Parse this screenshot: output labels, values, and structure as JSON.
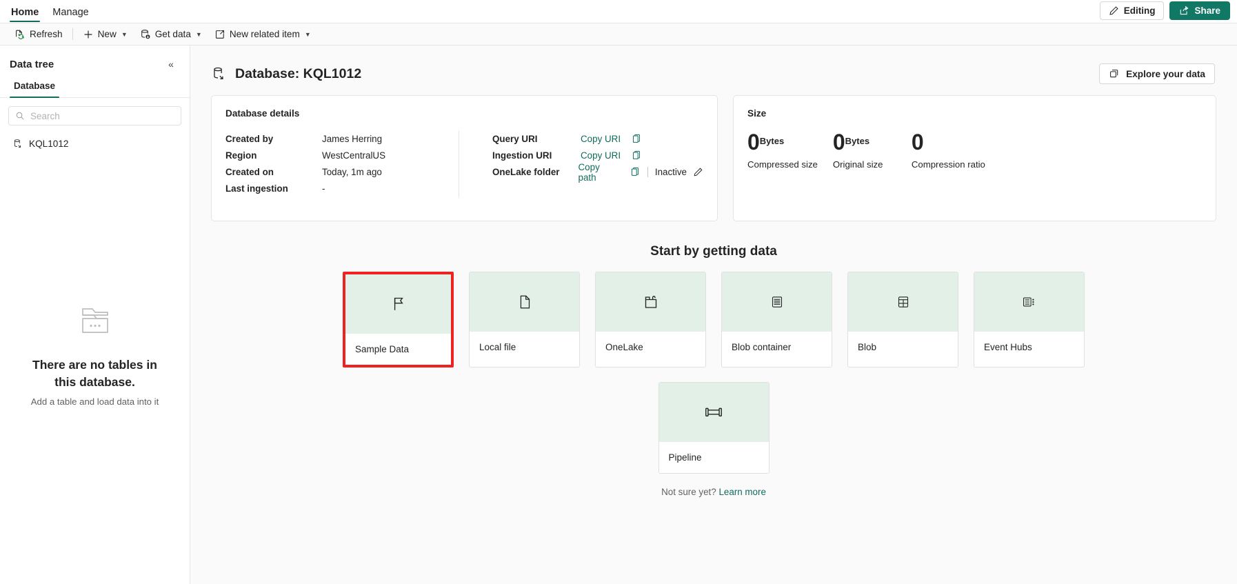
{
  "ribbon": {
    "tabs": [
      {
        "label": "Home",
        "active": true
      },
      {
        "label": "Manage",
        "active": false
      }
    ],
    "editing_label": "Editing",
    "share_label": "Share"
  },
  "commandbar": {
    "items": [
      {
        "label": "Refresh",
        "icon": "refresh-icon",
        "caret": false
      },
      {
        "label": "New",
        "icon": "plus-icon",
        "caret": true
      },
      {
        "label": "Get data",
        "icon": "get-data-icon",
        "caret": true
      },
      {
        "label": "New related item",
        "icon": "open-external-icon",
        "caret": true
      }
    ]
  },
  "sidebar": {
    "title": "Data tree",
    "collapse_glyph": "«",
    "tabs": [
      {
        "label": "Database",
        "active": true
      }
    ],
    "search": {
      "placeholder": "Search",
      "value": ""
    },
    "tree": [
      {
        "label": "KQL1012",
        "icon": "database-icon"
      }
    ],
    "empty": {
      "title": "There are no tables in this database.",
      "subtitle": "Add a table and load data into it"
    }
  },
  "main": {
    "page_title": "Database: KQL1012",
    "explore_button": "Explore your data",
    "details": {
      "title": "Database details",
      "left_rows": [
        {
          "label": "Created by",
          "value": "James Herring"
        },
        {
          "label": "Region",
          "value": "WestCentralUS"
        },
        {
          "label": "Created on",
          "value": "Today, 1m ago"
        },
        {
          "label": "Last ingestion",
          "value": "-"
        }
      ],
      "right_rows": [
        {
          "label": "Query URI",
          "link": "Copy URI",
          "extra": ""
        },
        {
          "label": "Ingestion URI",
          "link": "Copy URI",
          "extra": ""
        },
        {
          "label": "OneLake folder",
          "link": "Copy path",
          "extra": "Inactive"
        }
      ]
    },
    "size": {
      "title": "Size",
      "stats": [
        {
          "number": "0",
          "unit": "Bytes",
          "label": "Compressed size"
        },
        {
          "number": "0",
          "unit": "Bytes",
          "label": "Original size"
        },
        {
          "number": "0",
          "unit": "",
          "label": "Compression ratio"
        }
      ]
    },
    "getdata": {
      "heading": "Start by getting data",
      "tiles": [
        {
          "label": "Sample Data",
          "icon": "flag-icon",
          "highlighted": true
        },
        {
          "label": "Local file",
          "icon": "document-icon",
          "highlighted": false
        },
        {
          "label": "OneLake",
          "icon": "folder-icon",
          "highlighted": false
        },
        {
          "label": "Blob container",
          "icon": "blob-container-icon",
          "highlighted": false
        },
        {
          "label": "Blob",
          "icon": "blob-icon",
          "highlighted": false
        },
        {
          "label": "Event Hubs",
          "icon": "event-hubs-icon",
          "highlighted": false
        }
      ],
      "tiles_row2": [
        {
          "label": "Pipeline",
          "icon": "pipeline-icon",
          "highlighted": false
        }
      ],
      "footer_prefix": "Not sure yet? ",
      "footer_link": "Learn more"
    }
  },
  "colors": {
    "accent": "#0f6c5d",
    "share_bg": "#117865",
    "tile_hero": "#e2f0e8",
    "highlight": "#ef2222"
  }
}
